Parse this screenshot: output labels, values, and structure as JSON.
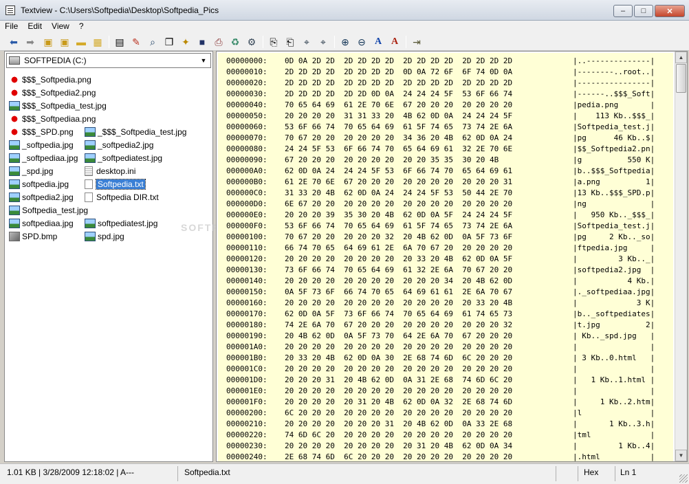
{
  "window": {
    "title": "Textview - C:\\Users\\Softpedia\\Desktop\\Softpedia_Pics"
  },
  "menu": [
    "File",
    "Edit",
    "View",
    "?"
  ],
  "toolbar": {
    "icons": [
      "back-arrow-icon",
      "forward-arrow-icon",
      "folder-up-icon",
      "folder-up-alt-icon",
      "folder-icon",
      "folder-favorite-icon",
      "properties-icon",
      "edit-icon",
      "find-file-icon",
      "copy-file-icon",
      "new-file-icon",
      "save-icon",
      "print-icon",
      "recycle-icon",
      "options-icon",
      "copy-icon",
      "paste-icon",
      "find-icon",
      "find-next-icon",
      "zoom-in-icon",
      "zoom-out-icon",
      "font-icon",
      "font-size-icon",
      "exit-icon"
    ]
  },
  "drive": {
    "label": "SOFTPEDIA (C:)"
  },
  "files": [
    {
      "name": "$$$_Softpedia.png",
      "type": "splat"
    },
    {
      "name": "$$$_Softpedia2.png",
      "type": "splat"
    },
    {
      "name": "$$$_Softpedia_test.jpg",
      "type": "img"
    },
    {
      "name": "$$$_Softpediaa.png",
      "type": "splat"
    },
    {
      "name": "$$$_SPD.png",
      "type": "splat"
    },
    {
      "name": "_$$$_Softpedia_test.jpg",
      "type": "img"
    },
    {
      "name": "_softpedia.jpg",
      "type": "img"
    },
    {
      "name": "_softpedia2.jpg",
      "type": "img"
    },
    {
      "name": "_softpediaa.jpg",
      "type": "img"
    },
    {
      "name": "_softpediatest.jpg",
      "type": "img"
    },
    {
      "name": "_spd.jpg",
      "type": "img"
    },
    {
      "name": "desktop.ini",
      "type": "ini"
    },
    {
      "name": "softpedia.jpg",
      "type": "img"
    },
    {
      "name": "Softpedia.txt",
      "type": "doc",
      "selected": true
    },
    {
      "name": "softpedia2.jpg",
      "type": "img"
    },
    {
      "name": "Softpedia DIR.txt",
      "type": "doc"
    },
    {
      "name": "Softpedia_test.jpg",
      "type": "img"
    },
    {
      "name": "softpediaa.jpg",
      "type": "img"
    },
    {
      "name": "softpediatest.jpg",
      "type": "img"
    },
    {
      "name": "SPD.bmp",
      "type": "bmp"
    },
    {
      "name": "spd.jpg",
      "type": "img"
    }
  ],
  "watermark": "SOFTP",
  "hex_rows": [
    {
      "addr": "00000000:",
      "bytes": "0D 0A 2D 2D  2D 2D 2D 2D  2D 2D 2D 2D  2D 2D 2D 2D",
      "ascii": "|..--------------|"
    },
    {
      "addr": "00000010:",
      "bytes": "2D 2D 2D 2D  2D 2D 2D 2D  0D 0A 72 6F  6F 74 0D 0A",
      "ascii": "|--------..root..|"
    },
    {
      "addr": "00000020:",
      "bytes": "2D 2D 2D 2D  2D 2D 2D 2D  2D 2D 2D 2D  2D 2D 2D 2D",
      "ascii": "|----------------|"
    },
    {
      "addr": "00000030:",
      "bytes": "2D 2D 2D 2D  2D 2D 0D 0A  24 24 24 5F  53 6F 66 74",
      "ascii": "|------..$$$_Soft|"
    },
    {
      "addr": "00000040:",
      "bytes": "70 65 64 69  61 2E 70 6E  67 20 20 20  20 20 20 20",
      "ascii": "|pedia.png       |"
    },
    {
      "addr": "00000050:",
      "bytes": "20 20 20 20  31 31 33 20  4B 62 0D 0A  24 24 24 5F",
      "ascii": "|    113 Kb..$$$_|"
    },
    {
      "addr": "00000060:",
      "bytes": "53 6F 66 74  70 65 64 69  61 5F 74 65  73 74 2E 6A",
      "ascii": "|Softpedia_test.j|"
    },
    {
      "addr": "00000070:",
      "bytes": "70 67 20 20  20 20 20 20  34 36 20 4B  62 0D 0A 24",
      "ascii": "|pg      46 Kb..$|"
    },
    {
      "addr": "00000080:",
      "bytes": "24 24 5F 53  6F 66 74 70  65 64 69 61  32 2E 70 6E",
      "ascii": "|$$_Softpedia2.pn|"
    },
    {
      "addr": "00000090:",
      "bytes": "67 20 20 20  20 20 20 20  20 20 35 35  30 20 4B",
      "ascii": "|g          550 K|"
    },
    {
      "addr": "000000A0:",
      "bytes": "62 0D 0A 24  24 24 5F 53  6F 66 74 70  65 64 69 61",
      "ascii": "|b..$$$_Softpedia|"
    },
    {
      "addr": "000000B0:",
      "bytes": "61 2E 70 6E  67 20 20 20  20 20 20 20  20 20 20 31",
      "ascii": "|a.png          1|"
    },
    {
      "addr": "000000C0:",
      "bytes": "31 33 20 4B  62 0D 0A 24  24 24 5F 53  50 44 2E 70",
      "ascii": "|13 Kb..$$$_SPD.p|"
    },
    {
      "addr": "000000D0:",
      "bytes": "6E 67 20 20  20 20 20 20  20 20 20 20  20 20 20 20",
      "ascii": "|ng              |"
    },
    {
      "addr": "000000E0:",
      "bytes": "20 20 20 39  35 30 20 4B  62 0D 0A 5F  24 24 24 5F",
      "ascii": "|   950 Kb.._$$$_|"
    },
    {
      "addr": "000000F0:",
      "bytes": "53 6F 66 74  70 65 64 69  61 5F 74 65  73 74 2E 6A",
      "ascii": "|Softpedia_test.j|"
    },
    {
      "addr": "00000100:",
      "bytes": "70 67 20 20  20 20 20 32  20 4B 62 0D  0A 5F 73 6F",
      "ascii": "|pg     2 Kb.._so|"
    },
    {
      "addr": "00000110:",
      "bytes": "66 74 70 65  64 69 61 2E  6A 70 67 20  20 20 20 20",
      "ascii": "|ftpedia.jpg     |"
    },
    {
      "addr": "00000120:",
      "bytes": "20 20 20 20  20 20 20 20  20 33 20 4B  62 0D 0A 5F",
      "ascii": "|         3 Kb.._|"
    },
    {
      "addr": "00000130:",
      "bytes": "73 6F 66 74  70 65 64 69  61 32 2E 6A  70 67 20 20",
      "ascii": "|softpedia2.jpg  |"
    },
    {
      "addr": "00000140:",
      "bytes": "20 20 20 20  20 20 20 20  20 20 20 34  20 4B 62 0D",
      "ascii": "|           4 Kb.|"
    },
    {
      "addr": "00000150:",
      "bytes": "0A 5F 73 6F  66 74 70 65  64 69 61 61  2E 6A 70 67",
      "ascii": "|._softpediaa.jpg|"
    },
    {
      "addr": "00000160:",
      "bytes": "20 20 20 20  20 20 20 20  20 20 20 20  20 33 20 4B",
      "ascii": "|             3 K|"
    },
    {
      "addr": "00000170:",
      "bytes": "62 0D 0A 5F  73 6F 66 74  70 65 64 69  61 74 65 73",
      "ascii": "|b.._softpediates|"
    },
    {
      "addr": "00000180:",
      "bytes": "74 2E 6A 70  67 20 20 20  20 20 20 20  20 20 20 32",
      "ascii": "|t.jpg          2|"
    },
    {
      "addr": "00000190:",
      "bytes": "20 4B 62 0D  0A 5F 73 70  64 2E 6A 70  67 20 20 20",
      "ascii": "| Kb.._spd.jpg   |"
    },
    {
      "addr": "000001A0:",
      "bytes": "20 20 20 20  20 20 20 20  20 20 20 20  20 20 20 20",
      "ascii": "|                |"
    },
    {
      "addr": "000001B0:",
      "bytes": "20 33 20 4B  62 0D 0A 30  2E 68 74 6D  6C 20 20 20",
      "ascii": "| 3 Kb..0.html   |"
    },
    {
      "addr": "000001C0:",
      "bytes": "20 20 20 20  20 20 20 20  20 20 20 20  20 20 20 20",
      "ascii": "|                |"
    },
    {
      "addr": "000001D0:",
      "bytes": "20 20 20 31  20 4B 62 0D  0A 31 2E 68  74 6D 6C 20",
      "ascii": "|   1 Kb..1.html |"
    },
    {
      "addr": "000001E0:",
      "bytes": "20 20 20 20  20 20 20 20  20 20 20 20  20 20 20 20",
      "ascii": "|                |"
    },
    {
      "addr": "000001F0:",
      "bytes": "20 20 20 20  20 31 20 4B  62 0D 0A 32  2E 68 74 6D",
      "ascii": "|     1 Kb..2.htm|"
    },
    {
      "addr": "00000200:",
      "bytes": "6C 20 20 20  20 20 20 20  20 20 20 20  20 20 20 20",
      "ascii": "|l               |"
    },
    {
      "addr": "00000210:",
      "bytes": "20 20 20 20  20 20 20 31  20 4B 62 0D  0A 33 2E 68",
      "ascii": "|       1 Kb..3.h|"
    },
    {
      "addr": "00000220:",
      "bytes": "74 6D 6C 20  20 20 20 20  20 20 20 20  20 20 20 20",
      "ascii": "|tml             |"
    },
    {
      "addr": "00000230:",
      "bytes": "20 20 20 20  20 20 20 20  20 31 20 4B  62 0D 0A 34",
      "ascii": "|         1 Kb..4|"
    },
    {
      "addr": "00000240:",
      "bytes": "2E 68 74 6D  6C 20 20 20  20 20 20 20  20 20 20 20",
      "ascii": "|.html           |"
    }
  ],
  "status": {
    "info": "1.01 KB | 3/28/2009 12:18:02 | A---",
    "file": "Softpedia.txt",
    "mode": "Hex",
    "line": "Ln 1"
  }
}
